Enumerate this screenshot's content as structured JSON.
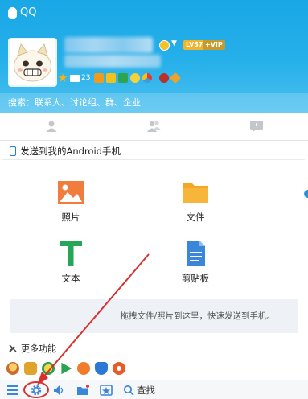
{
  "window": {
    "title": "QQ"
  },
  "profile": {
    "level_badge": "LV57",
    "vip_badge": "+VIP",
    "mail_count": "23"
  },
  "search": {
    "placeholder": "搜索：联系人、讨论组、群、企业"
  },
  "device": {
    "title": "发送到我的Android手机"
  },
  "features": [
    {
      "label": "照片",
      "icon": "image-icon"
    },
    {
      "label": "文件",
      "icon": "folder-icon"
    },
    {
      "label": "文本",
      "icon": "text-icon"
    },
    {
      "label": "剪贴板",
      "icon": "clipboard-icon"
    }
  ],
  "drop_zone": {
    "text": "拖拽文件/照片到这里，快速发送到手机。"
  },
  "more": {
    "label": "更多功能"
  },
  "bottom_bar": {
    "find_label": "查找"
  },
  "colors": {
    "header": "#1aa7e6",
    "accent": "#2b78d6",
    "annotation": "#d8302d"
  }
}
